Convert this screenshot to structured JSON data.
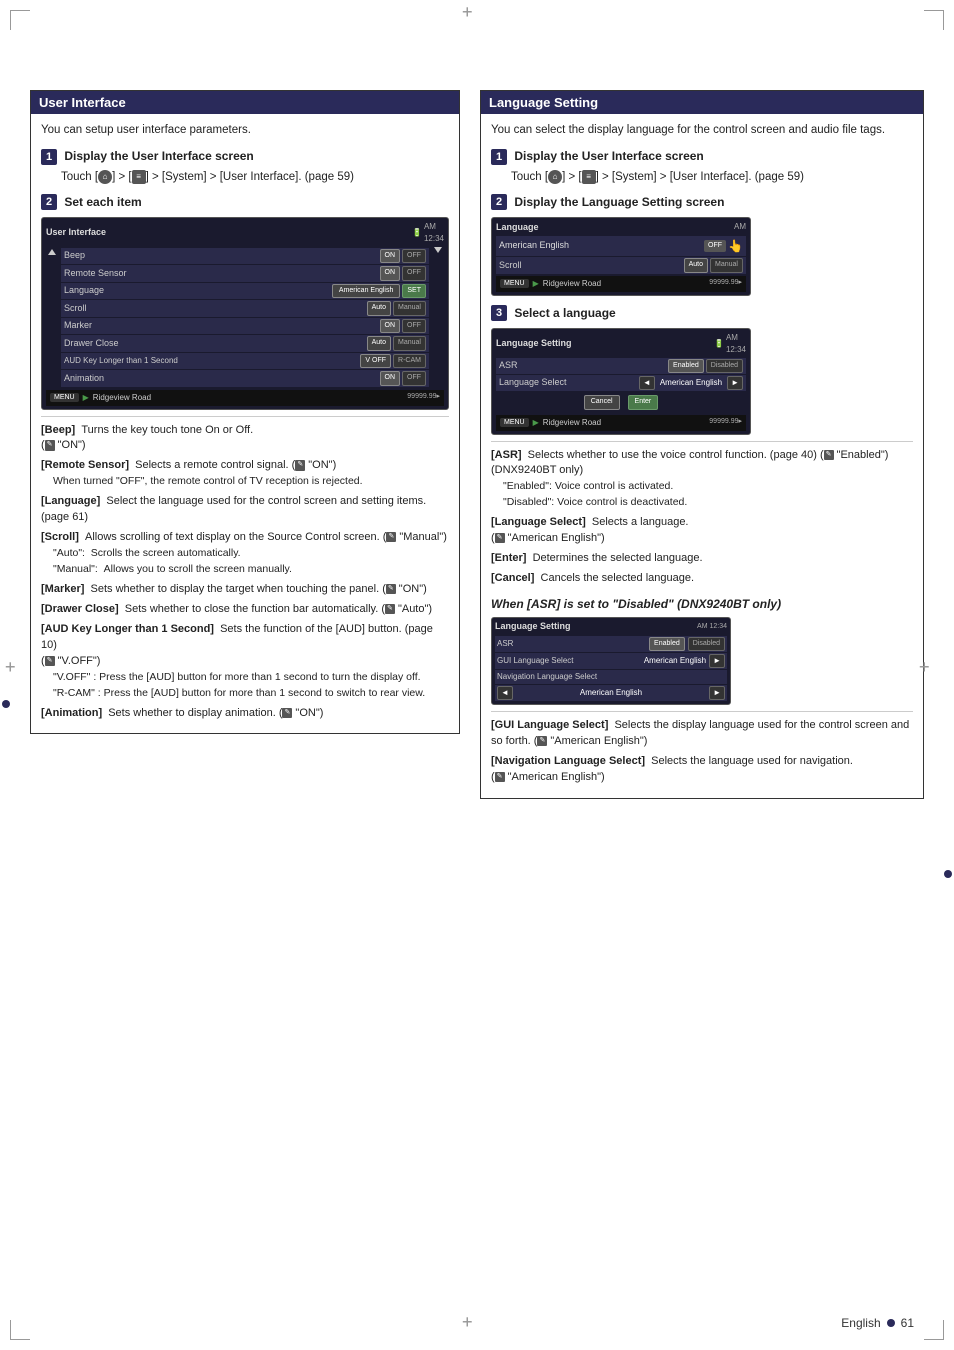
{
  "page": {
    "page_number": "61",
    "language": "English"
  },
  "left_section": {
    "header": "User Interface",
    "intro": "You can setup user interface parameters.",
    "step1": {
      "number": "1",
      "title": "Display the User Interface screen",
      "touch_text": "Touch [",
      "touch_path": "] > [",
      "touch_path2": "] > [System] > [User Interface]. (page 59)"
    },
    "step2": {
      "number": "2",
      "title": "Set each item"
    },
    "device_screen": {
      "title": "User Interface",
      "time": "AM 12:34",
      "rows": [
        {
          "label": "Beep",
          "controls": "ON_OFF"
        },
        {
          "label": "Remote Sensor",
          "controls": "ON_OFF"
        },
        {
          "label": "Language",
          "value": "American English",
          "controls": "SET"
        },
        {
          "label": "Scroll",
          "controls": "Auto_Manual"
        },
        {
          "label": "Marker",
          "controls": "ON_OFF"
        },
        {
          "label": "Drawer Close",
          "controls": "Auto_Manual"
        },
        {
          "label": "AUD Key Longer than 1 Second",
          "controls": "VOFF_RCAM"
        },
        {
          "label": "Animation",
          "controls": "ON_OFF"
        }
      ],
      "nav": {
        "menu": "MENU",
        "address": "Ridgeview Road",
        "mileage": "99999.99 ↑"
      }
    },
    "descriptions": [
      {
        "term": "[Beep]",
        "text": "Turns the key touch tone On or Off.",
        "note": "\"ON\")"
      },
      {
        "term": "[Remote Sensor]",
        "text": "Selects a remote control signal.",
        "note": "\"ON\")",
        "sub": "When turned \"OFF\", the remote control of TV reception is rejected."
      },
      {
        "term": "[Language]",
        "text": "Select the language used for the control screen and setting items. (page 61)"
      },
      {
        "term": "[Scroll]",
        "text": "Allows scrolling of text display on the Source Control screen.",
        "note": "\"Manual\")",
        "subs": [
          "\"Auto\":  Scrolls the screen automatically.",
          "\"Manual\":  Allows you to scroll the screen manually."
        ]
      },
      {
        "term": "[Marker]",
        "text": "Sets whether to display the target when touching the panel.",
        "note": "\"ON\")"
      },
      {
        "term": "[Drawer Close]",
        "text": "Sets whether to close the function bar automatically.",
        "note": "\"Auto\")"
      },
      {
        "term": "[AUD Key Longer than 1 Second]",
        "text": "Sets the function of the [AUD] button. (page 10)",
        "note": "\"V.OFF\")",
        "subs": [
          "\"V.OFF\" : Press the [AUD] button for more than 1 second to turn the display off.",
          "\"R-CAM\" : Press the [AUD] button for more than 1 second to switch to rear view."
        ]
      },
      {
        "term": "[Animation]",
        "text": "Sets whether to display animation.",
        "note": "\"ON\")"
      }
    ]
  },
  "right_section": {
    "header": "Language Setting",
    "intro": "You can select the display language for the control screen and audio file tags.",
    "step1": {
      "number": "1",
      "title": "Display the User Interface screen",
      "touch_text": "Touch [",
      "touch_path": "] > [System] > [User Interface]. (page 59)"
    },
    "step2": {
      "number": "2",
      "title": "Display the Language Setting screen",
      "screen": {
        "title": "Language",
        "time": "AM",
        "row1_label": "",
        "row1_value": "American English",
        "row2_label": "Scroll",
        "row2_controls": "Auto_Manual",
        "nav_menu": "MENU",
        "nav_address": "Ridgeview Road",
        "nav_mileage": "99999.99"
      }
    },
    "step3": {
      "number": "3",
      "title": "Select a language",
      "screen": {
        "title": "Language Setting",
        "time": "AM 12:34",
        "row_asr_label": "ASR",
        "row_asr_enabled": "Enabled",
        "row_asr_disabled": "Disabled",
        "row_lang_label": "Language Select",
        "row_lang_left": "◄",
        "row_lang_value": "American English",
        "row_lang_right": "►",
        "btn_cancel": "Cancel",
        "btn_enter": "Enter",
        "nav_menu": "MENU",
        "nav_address": "Ridgeview Road",
        "nav_mileage": "99999.99 ↑"
      }
    },
    "descriptions": [
      {
        "term": "[ASR]",
        "text": "Selects whether to use the voice control function. (page 40)",
        "note": "\"Enabled\")",
        "extra": "(DNX9240BT only)",
        "subs": [
          "\"Enabled\": Voice control is activated.",
          "\"Disabled\": Voice control is deactivated."
        ]
      },
      {
        "term": "[Language Select]",
        "text": "Selects a language.",
        "note": "\"American English\")"
      },
      {
        "term": "[Enter]",
        "text": "Determines the selected language."
      },
      {
        "term": "[Cancel]",
        "text": "Cancels the selected language."
      }
    ],
    "when_asr_disabled": {
      "title": "When [ASR] is set to \"Disabled\" (DNX9240BT only)",
      "screen": {
        "title": "Language Setting",
        "time": "AM 12:34",
        "row_asr_label": "ASR",
        "row_asr_enabled": "Enabled",
        "row_asr_disabled": "Disabled",
        "row_gui_label": "GUI Language Select",
        "row_gui_value": "American English",
        "row_gui_arrow": "►",
        "row_nav_label": "Navigation Language Select",
        "row_nav_left": "◄",
        "row_nav_value": "American English",
        "row_nav_arrow": "►"
      }
    },
    "when_descriptions": [
      {
        "term": "[GUI Language Select]",
        "text": "Selects the display language used for the control screen and so forth.",
        "note": "\"American English\")"
      },
      {
        "term": "[Navigation Language Select]",
        "text": "Selects the language used for navigation.",
        "note": "\"American English\")"
      }
    ]
  }
}
